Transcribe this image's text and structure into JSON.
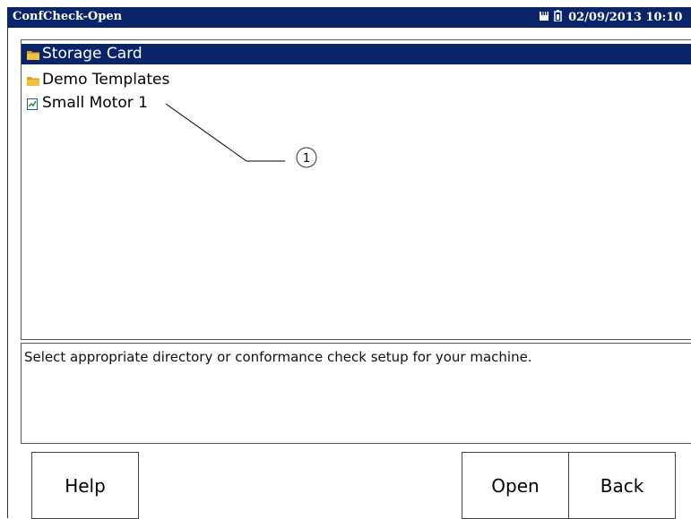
{
  "window": {
    "title": "ConfCheck-Open",
    "datetime": "02/09/2013 10:10",
    "icons": [
      "memory-card-icon",
      "battery-icon"
    ]
  },
  "list": {
    "items": [
      {
        "label": "Storage Card",
        "icon": "folder-icon",
        "selected": true
      },
      {
        "label": "Demo Templates",
        "icon": "folder-icon",
        "selected": false
      },
      {
        "label": "Small Motor 1",
        "icon": "setup-file-icon",
        "selected": false
      }
    ]
  },
  "callout": {
    "label": "1"
  },
  "description": "Select appropriate directory or conformance check setup for your machine.",
  "buttons": {
    "help": "Help",
    "open": "Open",
    "back": "Back"
  },
  "colors": {
    "titlebar": "#0a246a",
    "selection": "#0a246a",
    "folder": "#d9a21b"
  }
}
